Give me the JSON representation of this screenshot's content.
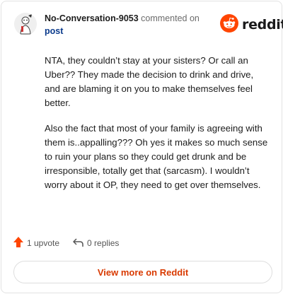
{
  "header": {
    "username": "No-Conversation-9053",
    "action_text": "commented on",
    "post_link": "post"
  },
  "logo": {
    "wordmark": "reddit",
    "icon": "reddit-snoo-icon",
    "brand_color": "#ff4500"
  },
  "comment": {
    "paragraphs": [
      "NTA, they couldn’t stay at your sisters? Or call an Uber?? They made the decision to drink and drive, and are blaming it on you to make themselves feel better.",
      "Also the fact that most of your family is agreeing with them is..appalling??? Oh yes it makes so much sense to ruin your plans so they could get drunk and be irresponsible, totally get that (sarcasm). I wouldn’t worry about it OP, they need to get over themselves."
    ]
  },
  "footer": {
    "upvotes": "1 upvote",
    "upvote_icon": "upvote-arrow-icon",
    "replies": "0 replies",
    "reply_icon": "reply-arrow-icon"
  },
  "view_more_label": "View more on Reddit",
  "colors": {
    "accent": "#d93a00",
    "link": "#0a3a8c",
    "upvote": "#ff4500"
  }
}
